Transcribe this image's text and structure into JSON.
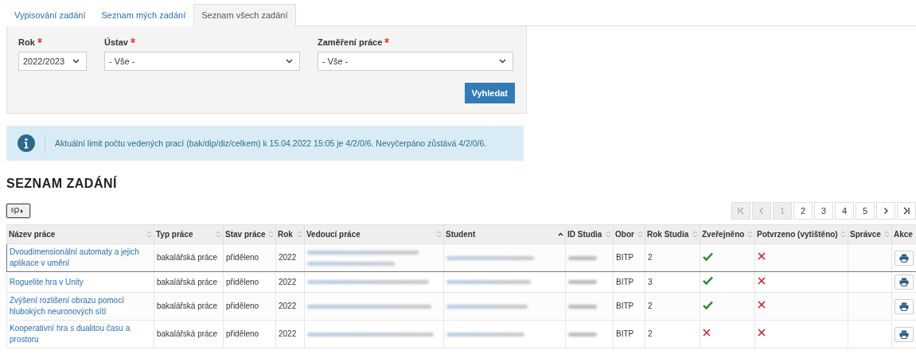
{
  "tabs": [
    {
      "label": "Vypisování zadání",
      "selected": false
    },
    {
      "label": "Seznam mých zadání",
      "selected": false
    },
    {
      "label": "Seznam všech zadání",
      "selected": true
    }
  ],
  "filters": [
    {
      "label": "Rok",
      "required": true,
      "value": "2022/2023"
    },
    {
      "label": "Ústav",
      "required": true,
      "value": "- Vše -"
    },
    {
      "label": "Zaměření práce",
      "required": true,
      "value": "- Vše -"
    }
  ],
  "search_button": "Vyhledat",
  "info": "Aktuální limit počtu vedených prací (bak/dip/diz/celkem) k 15.04.2022 15:05 je 4/2/0/6. Nevyčerpáno zůstává 4/2/0/6.",
  "section_title": "SEZNAM ZADÁNÍ",
  "pagination": {
    "pages": [
      {
        "label": "1",
        "selected": true
      },
      {
        "label": "2",
        "selected": false
      },
      {
        "label": "3",
        "selected": false
      },
      {
        "label": "4",
        "selected": false
      },
      {
        "label": "5",
        "selected": false
      }
    ],
    "first_disabled": true,
    "prev_disabled": true,
    "next_disabled": false,
    "last_disabled": false
  },
  "table": {
    "columns": [
      {
        "label": "Název práce",
        "sortable": true,
        "sorted": false
      },
      {
        "label": "Typ práce",
        "sortable": true,
        "sorted": false
      },
      {
        "label": "Stav práce",
        "sortable": true,
        "sorted": false
      },
      {
        "label": "Rok",
        "sortable": true,
        "sorted": false
      },
      {
        "label": "Vedoucí práce",
        "sortable": true,
        "sorted": false
      },
      {
        "label": "Student",
        "sortable": true,
        "sorted": true
      },
      {
        "label": "ID Studia",
        "sortable": true,
        "sorted": false
      },
      {
        "label": "Obor",
        "sortable": true,
        "sorted": false
      },
      {
        "label": "Rok Studia",
        "sortable": true,
        "sorted": false
      },
      {
        "label": "Zveřejněno",
        "sortable": true,
        "sorted": false
      },
      {
        "label": "Potvrzeno (vytištěno)",
        "sortable": true,
        "sorted": false
      },
      {
        "label": "Správce",
        "sortable": true,
        "sorted": false
      },
      {
        "label": "Akce",
        "sortable": false,
        "sorted": false
      }
    ],
    "rows": [
      {
        "title": "Dvoudimensionální automaty a jejich aplikace v umění",
        "type": "bakalářská práce",
        "state": "přiděleno",
        "year": "2022",
        "field": "BITP",
        "study_year": "2",
        "published": true,
        "confirmed": false,
        "selected": true
      },
      {
        "title": "Roguelite hra v Unity",
        "type": "bakalářská práce",
        "state": "přiděleno",
        "year": "2022",
        "field": "BITP",
        "study_year": "3",
        "published": true,
        "confirmed": false,
        "selected": false
      },
      {
        "title": "Zvýšení rozlišení obrazu pomocí hlubokých neuronových sítí",
        "type": "bakalářská práce",
        "state": "přiděleno",
        "year": "2022",
        "field": "BITP",
        "study_year": "2",
        "published": true,
        "confirmed": false,
        "selected": false
      },
      {
        "title": "Kooperativní hra s dualitou času a prostoru",
        "type": "bakalářská práce",
        "state": "přiděleno",
        "year": "2022",
        "field": "BITP",
        "study_year": "2",
        "published": false,
        "confirmed": false,
        "selected": false
      }
    ]
  }
}
